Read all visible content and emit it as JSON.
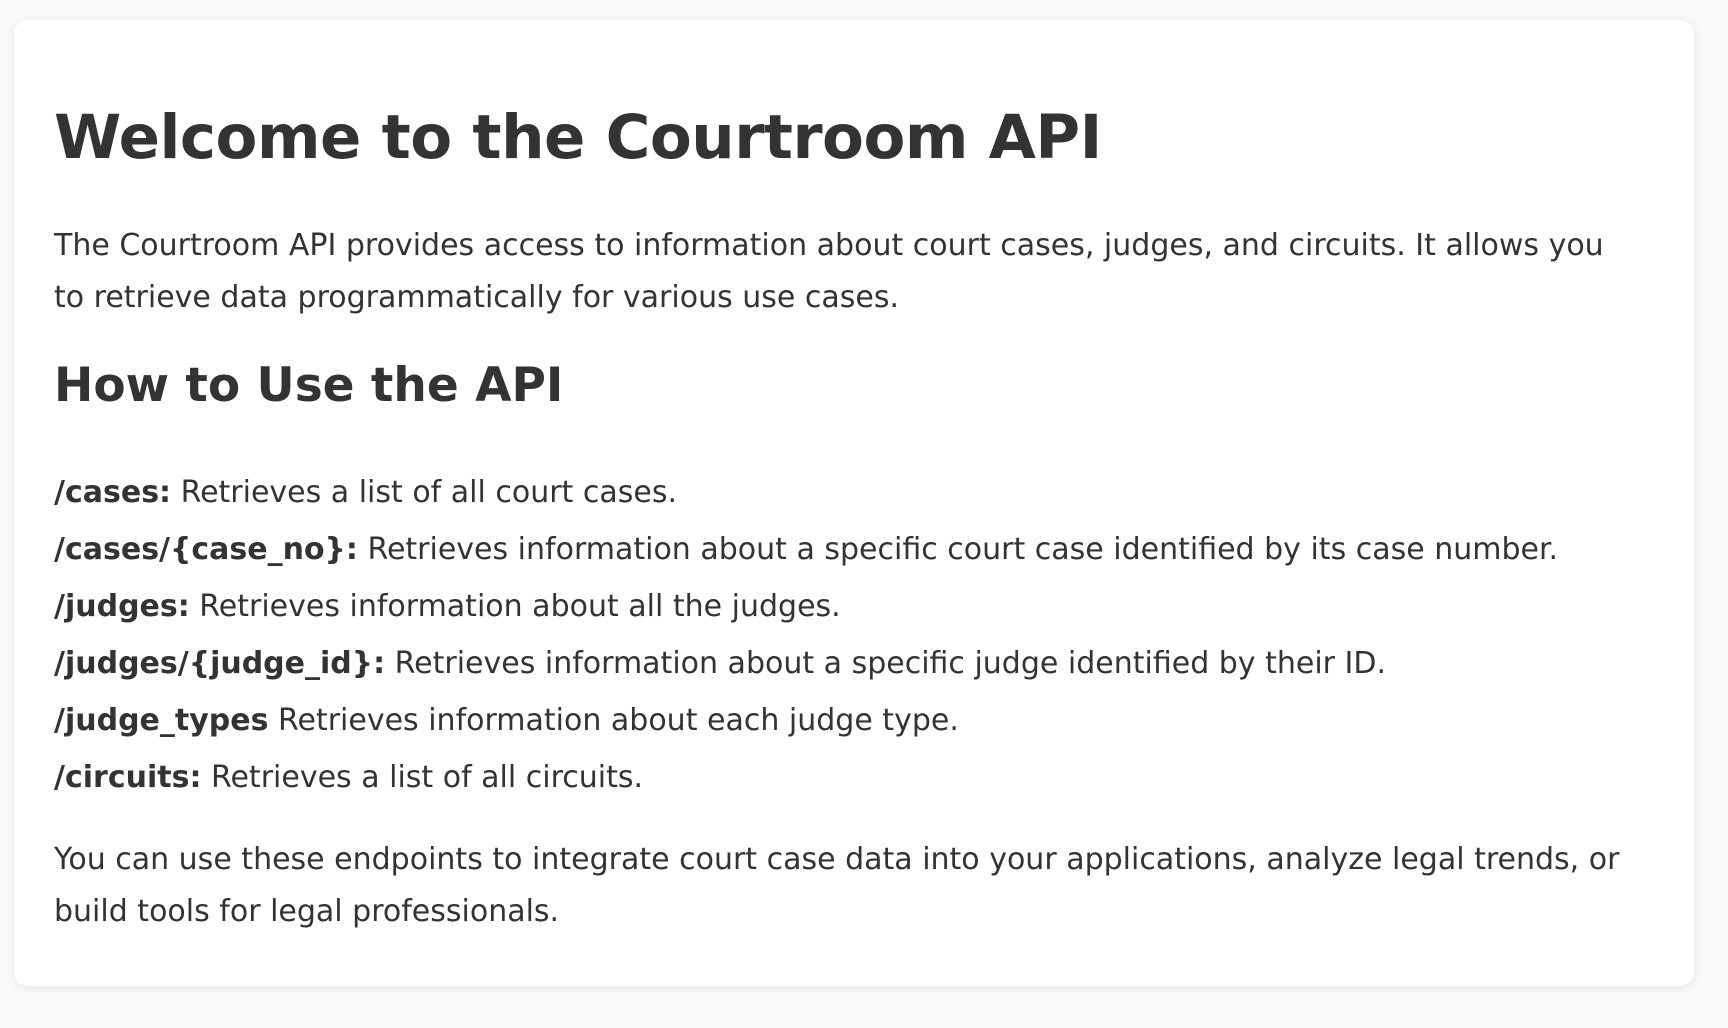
{
  "page": {
    "title": "Welcome to the Courtroom API",
    "intro": "The Courtroom API provides access to information about court cases, judges, and circuits. It allows you to retrieve data programmatically for various use cases.",
    "section_heading": "How to Use the API",
    "endpoints": [
      {
        "path": "/cases:",
        "description": " Retrieves a list of all court cases."
      },
      {
        "path": "/cases/{case_no}:",
        "description": " Retrieves information about a specific court case identified by its case number."
      },
      {
        "path": "/judges:",
        "description": " Retrieves information about all the judges."
      },
      {
        "path": "/judges/{judge_id}:",
        "description": " Retrieves information about a specific judge identified by their ID."
      },
      {
        "path": "/judge_types",
        "description": " Retrieves information about each judge type."
      },
      {
        "path": "/circuits:",
        "description": " Retrieves a list of all circuits."
      }
    ],
    "outro": "You can use these endpoints to integrate court case data into your applications, analyze legal trends, or build tools for legal professionals."
  },
  "colors": {
    "background": "#f9f9f9",
    "card": "#ffffff",
    "text": "#333333"
  }
}
